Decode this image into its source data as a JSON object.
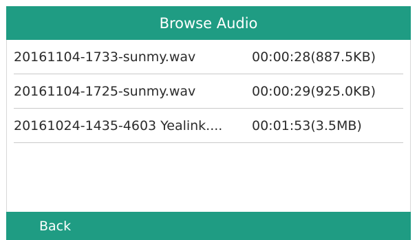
{
  "header": {
    "title": "Browse Audio"
  },
  "recordings": [
    {
      "name": "20161104-1733-sunmy.wav",
      "meta": "00:00:28(887.5KB)"
    },
    {
      "name": "20161104-1725-sunmy.wav",
      "meta": "00:00:29(925.0KB)"
    },
    {
      "name": "20161024-1435-4603 Yealink....",
      "meta": "00:01:53(3.5MB)"
    }
  ],
  "softkeys": {
    "back_label": "Back"
  },
  "colors": {
    "accent": "#1f9c83",
    "text": "#2b2b2b",
    "divider": "#c9c9c9"
  }
}
